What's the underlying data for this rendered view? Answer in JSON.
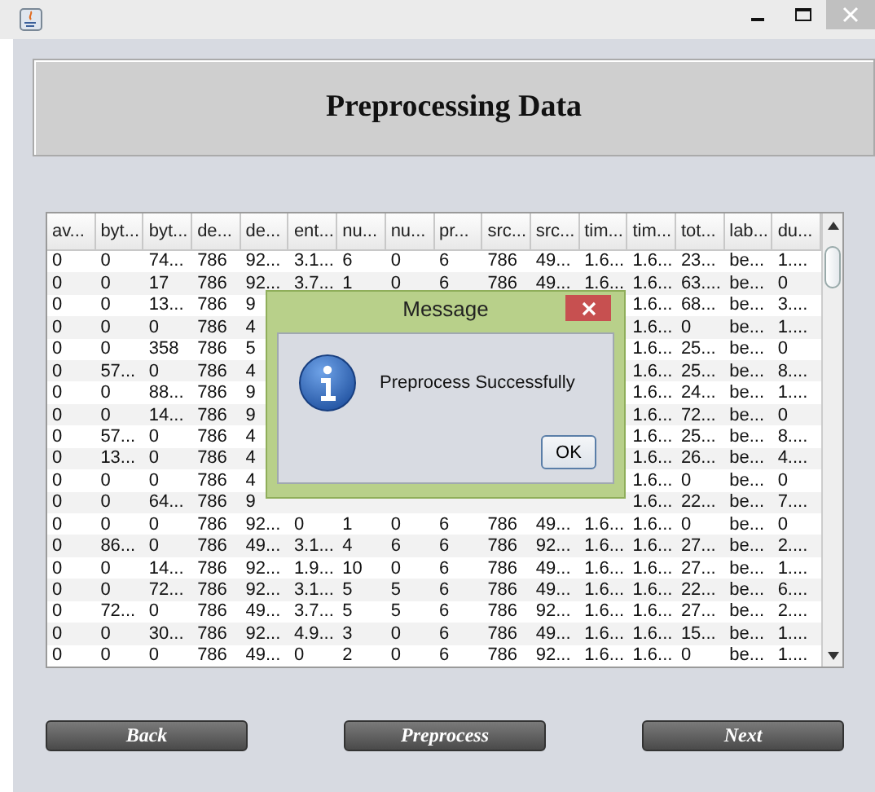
{
  "header": {
    "title": "Preprocessing Data"
  },
  "table": {
    "columns": [
      "av...",
      "byt...",
      "byt...",
      "de...",
      "de...",
      "ent...",
      "nu...",
      "nu...",
      "pr...",
      "src...",
      "src...",
      "tim...",
      "tim...",
      "tot...",
      "lab...",
      "du..."
    ],
    "rows": [
      [
        "0",
        "0",
        "74...",
        "786",
        "92...",
        "3.1...",
        "6",
        "0",
        "6",
        "786",
        "49...",
        "1.6...",
        "1.6...",
        "23...",
        "be...",
        "1...."
      ],
      [
        "0",
        "0",
        "17",
        "786",
        "92...",
        "3.7...",
        "1",
        "0",
        "6",
        "786",
        "49...",
        "1.6...",
        "1.6...",
        "63....",
        "be...",
        "0"
      ],
      [
        "0",
        "0",
        "13...",
        "786",
        "9",
        null,
        null,
        null,
        null,
        null,
        null,
        null,
        "1.6...",
        "68...",
        "be...",
        "3...."
      ],
      [
        "0",
        "0",
        "0",
        "786",
        "4",
        null,
        null,
        null,
        null,
        null,
        null,
        null,
        "1.6...",
        "0",
        "be...",
        "1...."
      ],
      [
        "0",
        "0",
        "358",
        "786",
        "5",
        null,
        null,
        null,
        null,
        null,
        null,
        null,
        "1.6...",
        "25...",
        "be...",
        "0"
      ],
      [
        "0",
        "57...",
        "0",
        "786",
        "4",
        null,
        null,
        null,
        null,
        null,
        null,
        null,
        "1.6...",
        "25...",
        "be...",
        "8...."
      ],
      [
        "0",
        "0",
        "88...",
        "786",
        "9",
        null,
        null,
        null,
        null,
        null,
        null,
        null,
        "1.6...",
        "24...",
        "be...",
        "1...."
      ],
      [
        "0",
        "0",
        "14...",
        "786",
        "9",
        null,
        null,
        null,
        null,
        null,
        null,
        null,
        "1.6...",
        "72...",
        "be...",
        "0"
      ],
      [
        "0",
        "57...",
        "0",
        "786",
        "4",
        null,
        null,
        null,
        null,
        null,
        null,
        null,
        "1.6...",
        "25...",
        "be...",
        "8...."
      ],
      [
        "0",
        "13...",
        "0",
        "786",
        "4",
        null,
        null,
        null,
        null,
        null,
        null,
        null,
        "1.6...",
        "26...",
        "be...",
        "4...."
      ],
      [
        "0",
        "0",
        "0",
        "786",
        "4",
        null,
        null,
        null,
        null,
        null,
        null,
        null,
        "1.6...",
        "0",
        "be...",
        "0"
      ],
      [
        "0",
        "0",
        "64...",
        "786",
        "9",
        null,
        null,
        null,
        null,
        null,
        null,
        null,
        "1.6...",
        "22...",
        "be...",
        "7...."
      ],
      [
        "0",
        "0",
        "0",
        "786",
        "92...",
        "0",
        "1",
        "0",
        "6",
        "786",
        "49...",
        "1.6...",
        "1.6...",
        "0",
        "be...",
        "0"
      ],
      [
        "0",
        "86...",
        "0",
        "786",
        "49...",
        "3.1...",
        "4",
        "6",
        "6",
        "786",
        "92...",
        "1.6...",
        "1.6...",
        "27...",
        "be...",
        "2...."
      ],
      [
        "0",
        "0",
        "14...",
        "786",
        "92...",
        "1.9...",
        "10",
        "0",
        "6",
        "786",
        "49...",
        "1.6...",
        "1.6...",
        "27...",
        "be...",
        "1...."
      ],
      [
        "0",
        "0",
        "72...",
        "786",
        "92...",
        "3.1...",
        "5",
        "5",
        "6",
        "786",
        "49...",
        "1.6...",
        "1.6...",
        "22...",
        "be...",
        "6...."
      ],
      [
        "0",
        "72...",
        "0",
        "786",
        "49...",
        "3.7...",
        "5",
        "5",
        "6",
        "786",
        "92...",
        "1.6...",
        "1.6...",
        "27...",
        "be...",
        "2...."
      ],
      [
        "0",
        "0",
        "30...",
        "786",
        "92...",
        "4.9...",
        "3",
        "0",
        "6",
        "786",
        "49...",
        "1.6...",
        "1.6...",
        "15...",
        "be...",
        "1...."
      ],
      [
        "0",
        "0",
        "0",
        "786",
        "49...",
        "0",
        "2",
        "0",
        "6",
        "786",
        "92...",
        "1.6...",
        "1.6...",
        "0",
        "be...",
        "1...."
      ]
    ]
  },
  "buttons": [
    "Back",
    "Preprocess",
    "Next"
  ],
  "dialog": {
    "title": "Message",
    "message": "Preprocess Successfully",
    "button": "OK"
  }
}
